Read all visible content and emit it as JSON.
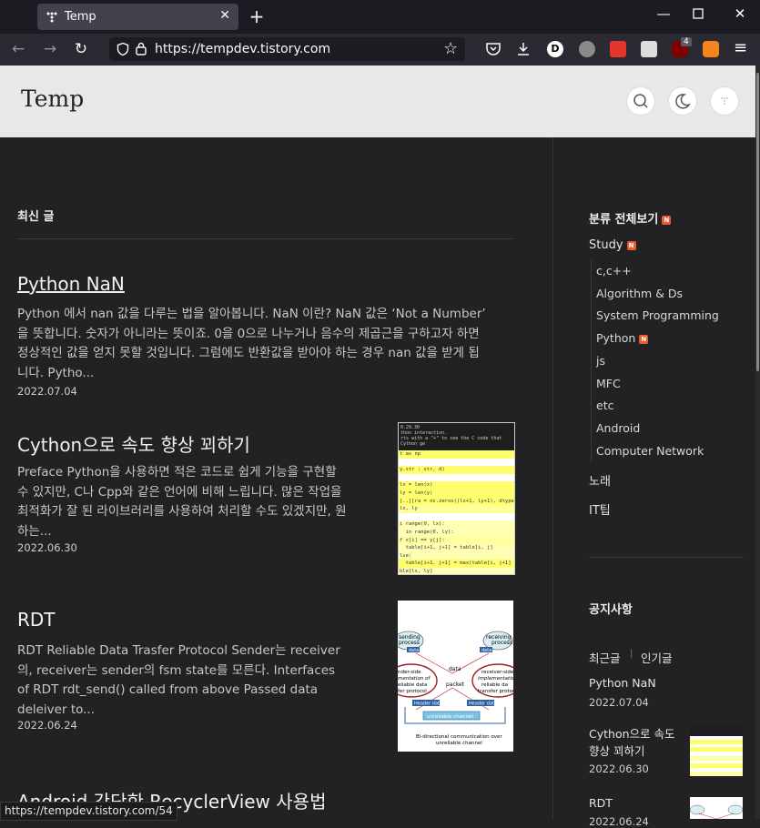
{
  "browser": {
    "tab_title": "Temp",
    "url": "https://tempdev.tistory.com",
    "status_url": "https://tempdev.tistory.com/54",
    "ublock_count": "4"
  },
  "blog": {
    "title": "Temp"
  },
  "main": {
    "section_heading": "최신 글",
    "posts": [
      {
        "title": "Python NaN",
        "excerpt": "Python 에서 nan 값을 다루는 법을 알아봅니다. NaN 이란? NaN 값은 ‘Not a Number’ 을 뜻합니다. 숫자가 아니라는 뜻이죠. 0을 0으로 나누거나 음수의 제곱근을 구하고자 하면 정상적인 값을 얻지 못할 것입니다. 그럼에도 반환값을 받아야 하는 경우 nan 값을 받게 됩니다. Pytho...",
        "date": "2022.07.04"
      },
      {
        "title": "Cython으로 속도 향상 꾀하기",
        "excerpt": "Preface Python을 사용하면 적은 코드로 쉽게 기능을 구현할 수 있지만, C나 Cpp와 같은 언어에 비해 느립니다. 많은 작업을 최적화가 잘 된 라이브러리를 사용하여 처리할 수도 있겠지만, 원하는...",
        "date": "2022.06.30"
      },
      {
        "title": "RDT",
        "excerpt": "RDT Reliable Data Trasfer Protocol Sender는 receiver의, receiver는 sender의 fsm state를 모른다. Interfaces of RDT rdt_send() called from above Passed data deleiver to...",
        "date": "2022.06.24"
      },
      {
        "title": "Android 간단한 RecyclerView 사용법"
      }
    ],
    "cython_thumb": {
      "header": "0.29.30",
      "line1": "thon interaction.",
      "line2": "rts with a \"+\" to see the C code that Cython ge",
      "code": [
        "t as np",
        "",
        "y.str : str, d)",
        "",
        "lx = len(x)",
        "ly = len(y)",
        "[..][ra = ns.zeros((lx+1, ly+1), dtype=",
        "lx, ly",
        "",
        "i range(0, lx):",
        "  in range(0, ly):",
        "f x[i] == y[j]:",
        "  table[i+1, j+1] = table[i, j]",
        "lse:",
        "  table[i+1, j+1] = max(table[i, j+1]",
        "ble[lx, ly]"
      ]
    },
    "rdt_thumb": {
      "sending": "sending process",
      "receiving": "receiving process",
      "data": "data",
      "sender_side": "sender-side implementation of reliable data transfer protocol",
      "receiver_side": "receiver-side implementation of reliable data transfer protocol",
      "packet": "packet",
      "header": "Header",
      "channel": "unreliable channel",
      "caption": "Bi-directional communication over unreliable channel"
    }
  },
  "sidebar": {
    "all_categories": "분류 전체보기",
    "new_badge": "N",
    "study": "Study",
    "study_items": [
      "c,c++",
      "Algorithm & Ds",
      "System Programming",
      "Python",
      "js",
      "MFC",
      "etc",
      "Android",
      "Computer Network"
    ],
    "songs": "노래",
    "ittip": "IT팁",
    "notice": "공지사항",
    "tab_recent": "최근글",
    "tab_separator": "|",
    "tab_popular": "인기글",
    "recent": [
      {
        "title": "Python NaN",
        "date": "2022.07.04"
      },
      {
        "title": "Cython으로 속도 향상 꾀하기",
        "date": "2022.06.30"
      },
      {
        "title": "RDT",
        "date": "2022.06.24"
      }
    ]
  }
}
